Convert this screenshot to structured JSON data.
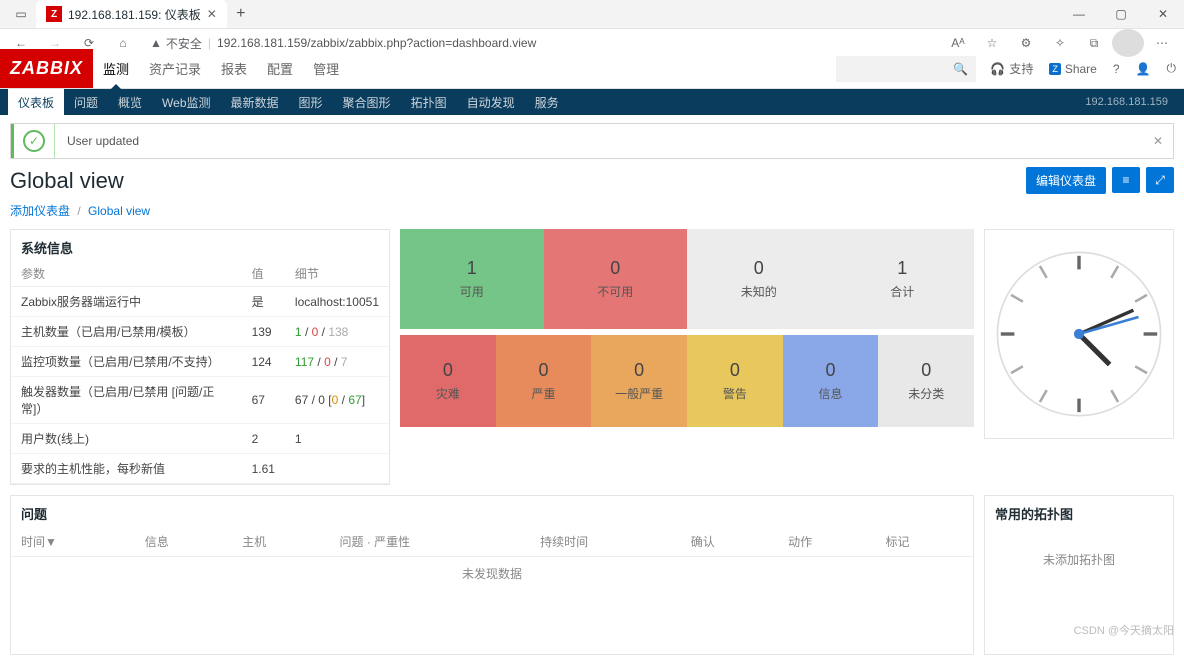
{
  "browser": {
    "tab_title": "192.168.181.159: 仪表板",
    "insecure_label": "不安全",
    "url": "192.168.181.159/zabbix/zabbix.php?action=dashboard.view",
    "aa_label": "Aᴬ"
  },
  "header": {
    "logo": "ZABBIX",
    "nav": [
      "监测",
      "资产记录",
      "报表",
      "配置",
      "管理"
    ],
    "support": "支持",
    "share": "Share",
    "search_placeholder": ""
  },
  "subnav": {
    "items": [
      "仪表板",
      "问题",
      "概览",
      "Web监测",
      "最新数据",
      "图形",
      "聚合图形",
      "拓扑图",
      "自动发现",
      "服务"
    ],
    "ip": "192.168.181.159"
  },
  "alert": {
    "text": "User updated"
  },
  "page": {
    "title": "Global view",
    "edit_btn": "编辑仪表盘",
    "breadcrumb_add": "添加仪表盘",
    "breadcrumb_current": "Global view"
  },
  "sysinfo": {
    "title": "系统信息",
    "cols": {
      "param": "参数",
      "value": "值",
      "detail": "细节"
    },
    "rows": [
      {
        "param": "Zabbix服务器端运行中",
        "value": "是",
        "value_cls": "green",
        "detail": "localhost:10051"
      },
      {
        "param": "主机数量（已启用/已禁用/模板）",
        "value": "139",
        "d1": "1",
        "d2": " / ",
        "d3": "0",
        "d4": " / ",
        "d5": "138"
      },
      {
        "param": "监控项数量（已启用/已禁用/不支持）",
        "value": "124",
        "d1": "117",
        "d2": " / ",
        "d3": "0",
        "d4": " / ",
        "d5": "7"
      },
      {
        "param": "触发器数量（已启用/已禁用 [问题/正常]）",
        "value": "67",
        "d_raw": "67 / 0 [0 / 67]"
      },
      {
        "param": "用户数(线上)",
        "value": "2",
        "detail": "1"
      },
      {
        "param": "要求的主机性能，每秒新值",
        "value": "1.61",
        "detail": ""
      }
    ]
  },
  "tiles_top": [
    {
      "num": "1",
      "lbl": "可用",
      "cls": "c-green"
    },
    {
      "num": "0",
      "lbl": "不可用",
      "cls": "c-red"
    },
    {
      "num": "0",
      "lbl": "未知的",
      "cls": "c-grey"
    },
    {
      "num": "1",
      "lbl": "合计",
      "cls": "c-grey"
    }
  ],
  "tiles_bottom": [
    {
      "num": "0",
      "lbl": "灾难",
      "cls": "c-darkred"
    },
    {
      "num": "0",
      "lbl": "严重",
      "cls": "c-orange1"
    },
    {
      "num": "0",
      "lbl": "一般严重",
      "cls": "c-orange2"
    },
    {
      "num": "0",
      "lbl": "警告",
      "cls": "c-yellow"
    },
    {
      "num": "0",
      "lbl": "信息",
      "cls": "c-blue"
    },
    {
      "num": "0",
      "lbl": "未分类",
      "cls": "c-lightgrey"
    }
  ],
  "problems": {
    "title": "问题",
    "cols": [
      "时间▼",
      "信息",
      "主机",
      "问题 · 严重性",
      "持续时间",
      "确认",
      "动作",
      "标记"
    ],
    "empty": "未发现数据"
  },
  "maps": {
    "title": "常用的拓扑图",
    "empty": "未添加拓扑图"
  },
  "watermark": "CSDN @今天摘太阳"
}
